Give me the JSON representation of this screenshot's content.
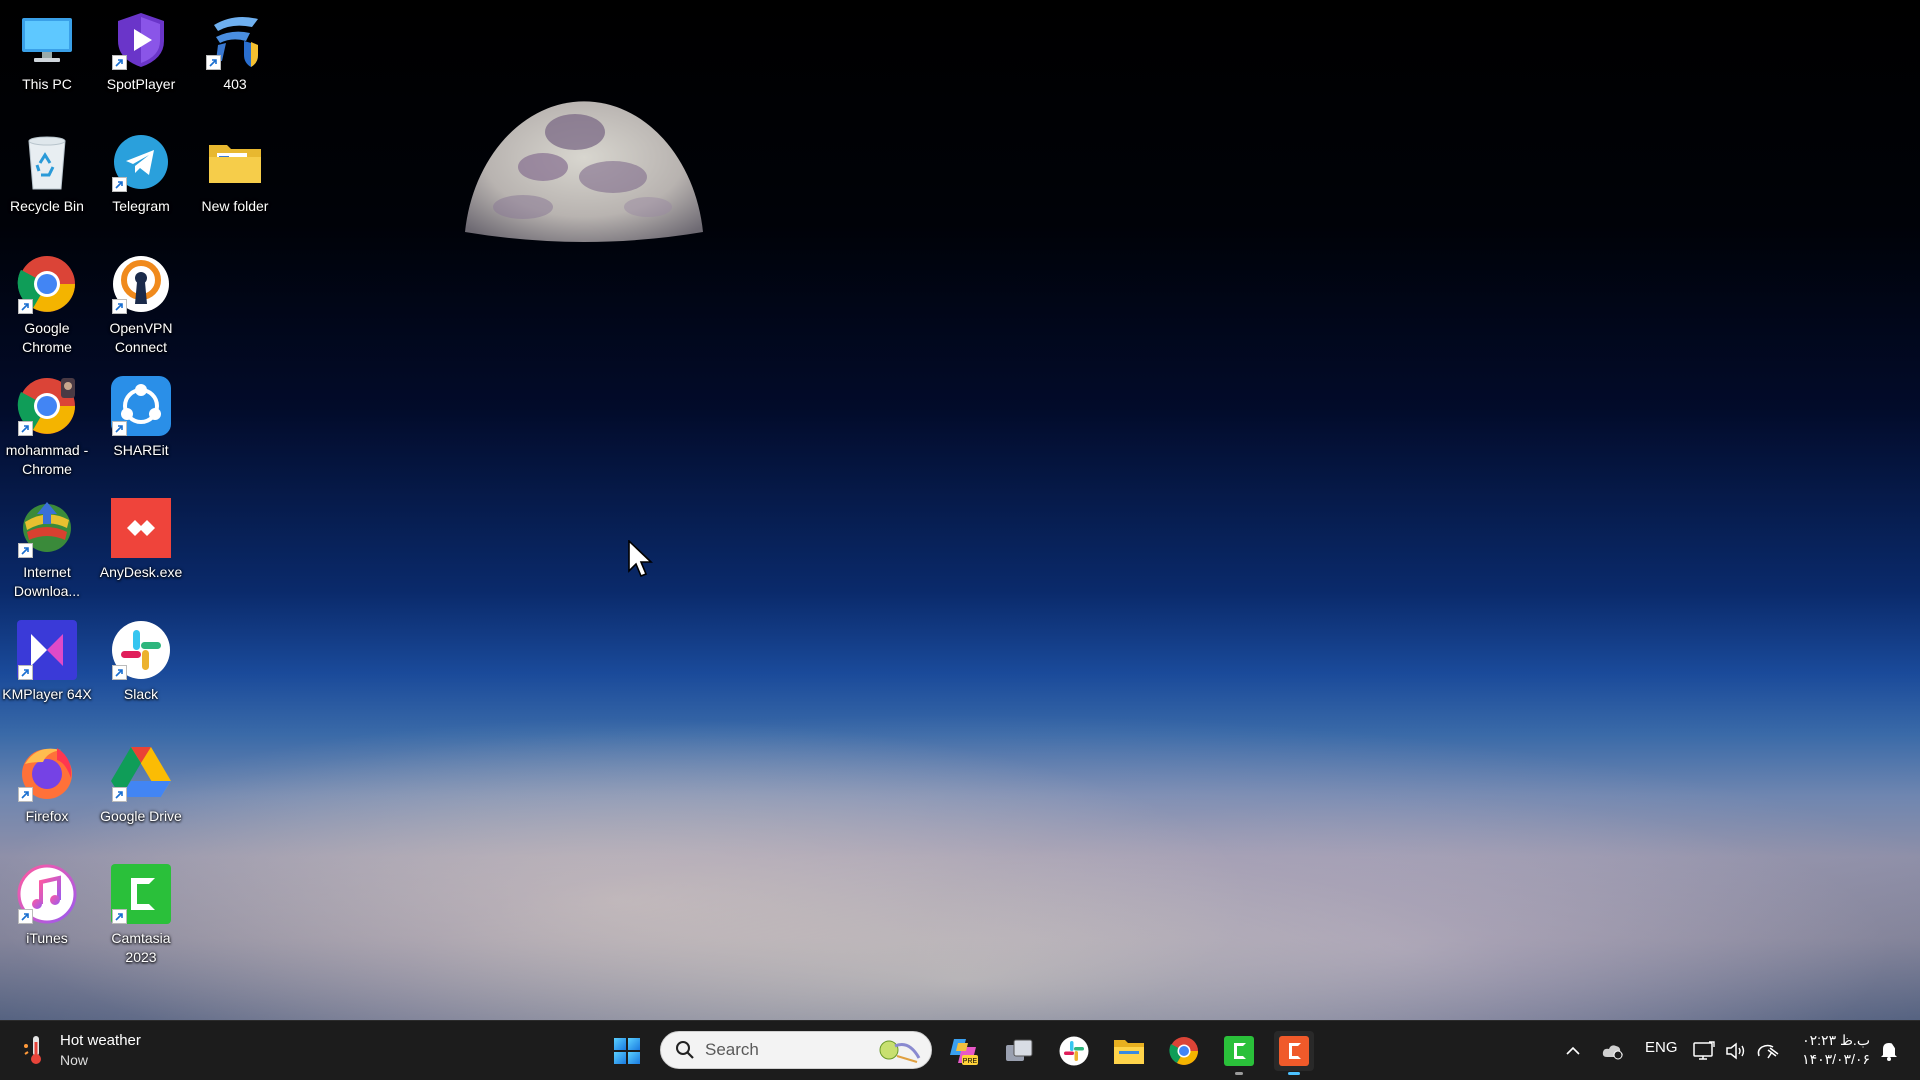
{
  "desktop": {
    "icons": [
      {
        "label": "This PC",
        "icon": "this-pc-icon"
      },
      {
        "label": "SpotPlayer",
        "icon": "spotplayer-icon"
      },
      {
        "label": "403",
        "icon": "403-icon"
      },
      {
        "label": "Recycle Bin",
        "icon": "recycle-bin-icon"
      },
      {
        "label": "Telegram",
        "icon": "telegram-icon"
      },
      {
        "label": "New folder",
        "icon": "folder-icon"
      },
      {
        "label": "Google Chrome",
        "icon": "chrome-icon"
      },
      {
        "label": "OpenVPN Connect",
        "icon": "openvpn-icon"
      },
      {
        "label": "mohammad - Chrome",
        "icon": "chrome-profile-icon"
      },
      {
        "label": "SHAREit",
        "icon": "shareit-icon"
      },
      {
        "label": "Internet Downloa...",
        "icon": "idm-icon"
      },
      {
        "label": "AnyDesk.exe",
        "icon": "anydesk-icon"
      },
      {
        "label": "KMPlayer 64X",
        "icon": "kmplayer-icon"
      },
      {
        "label": "Slack",
        "icon": "slack-icon"
      },
      {
        "label": "Firefox",
        "icon": "firefox-icon"
      },
      {
        "label": "Google Drive",
        "icon": "google-drive-icon"
      },
      {
        "label": "iTunes",
        "icon": "itunes-icon"
      },
      {
        "label": "Camtasia 2023",
        "icon": "camtasia-icon"
      }
    ]
  },
  "taskbar": {
    "weather": {
      "title": "Hot weather",
      "subtitle": "Now"
    },
    "search": {
      "placeholder": "Search"
    },
    "apps": [
      "start-icon",
      "copilot-icon",
      "task-view-icon",
      "slack-icon",
      "file-explorer-icon",
      "chrome-icon",
      "camtasia-recorder-icon",
      "camtasia-editor-icon"
    ],
    "tray": {
      "language": "ENG"
    },
    "clock": {
      "time": "ب.ظ ۰۲:۲۳",
      "date": "۱۴۰۳/۰۳/۰۶"
    }
  },
  "colors": {
    "taskbar_bg": "#1c1c1c",
    "accent": "#4cc2ff"
  }
}
